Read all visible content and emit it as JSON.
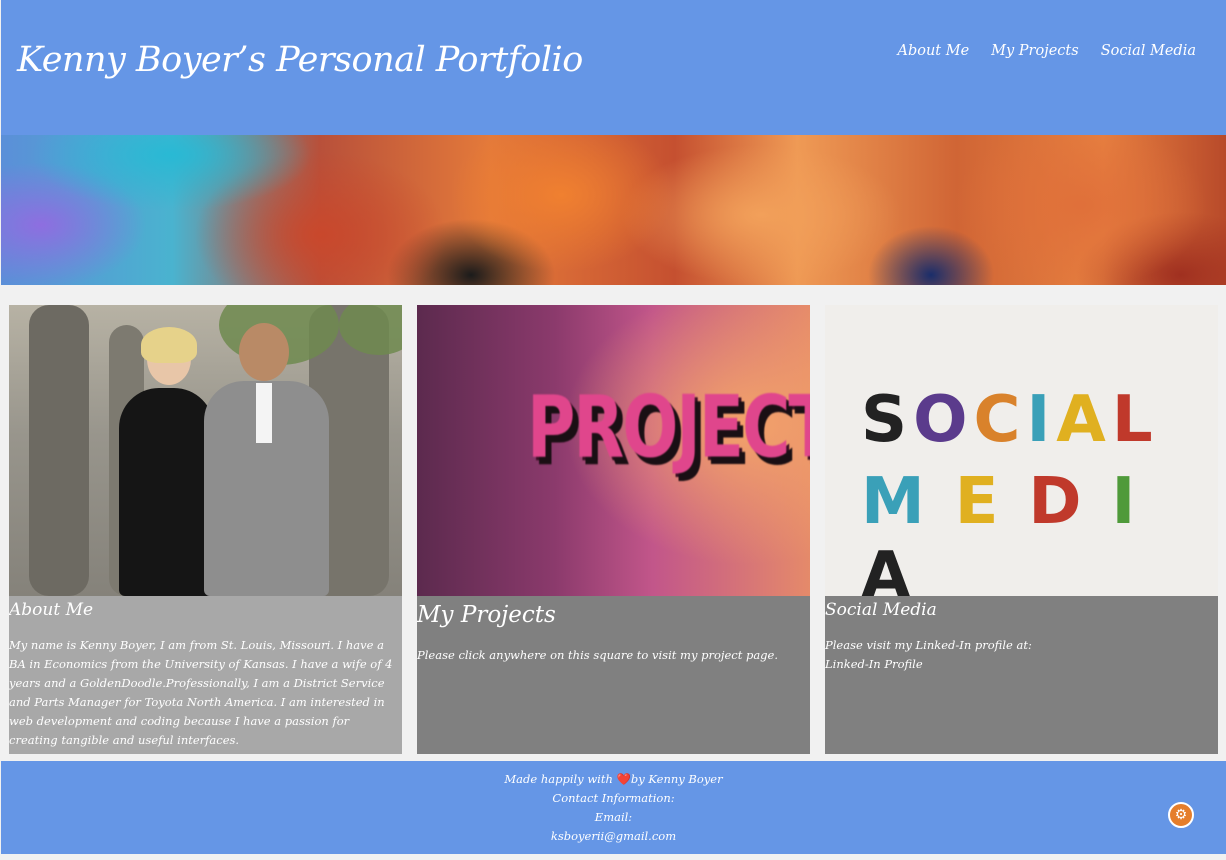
{
  "header": {
    "title": "Kenny Boyer’s Personal Portfolio",
    "nav": [
      "About Me",
      "My Projects",
      "Social Media"
    ]
  },
  "cards": [
    {
      "title": "About Me",
      "text": "My name is Kenny Boyer, I am from St. Louis, Missouri. I have a BA in Economics from the University of Kansas. I have a wife of 4 years and a GoldenDoodle.Professionally, I am a District Service and Parts Manager for Toyota North America. I am interested in web development and coding because I have a passion for creating tangible and useful interfaces."
    },
    {
      "title": "My Projects",
      "text": "Please click anywhere on this square to visit my project page.",
      "image_text": "PROJECTS"
    },
    {
      "title": "Social Media",
      "text": "Please visit my Linked-In profile at:",
      "link": "Linked-In Profile",
      "image_text_line1": "SOCIAL",
      "image_text_line2": "MEDIA"
    }
  ],
  "footer": {
    "made_prefix": "Made happily with",
    "made_suffix": "by Kenny Boyer",
    "contact_label": "Contact Information:",
    "email_label": "Email:",
    "email": "ksboyerii@gmail.com"
  },
  "colors": {
    "header_bg": "#6596e6",
    "footer_bg": "#6596e6",
    "about_body_bg": "#a8a8a8",
    "card_body_bg": "#808080"
  },
  "icons": {
    "heart": "heart-icon",
    "settings": "settings-icon"
  }
}
